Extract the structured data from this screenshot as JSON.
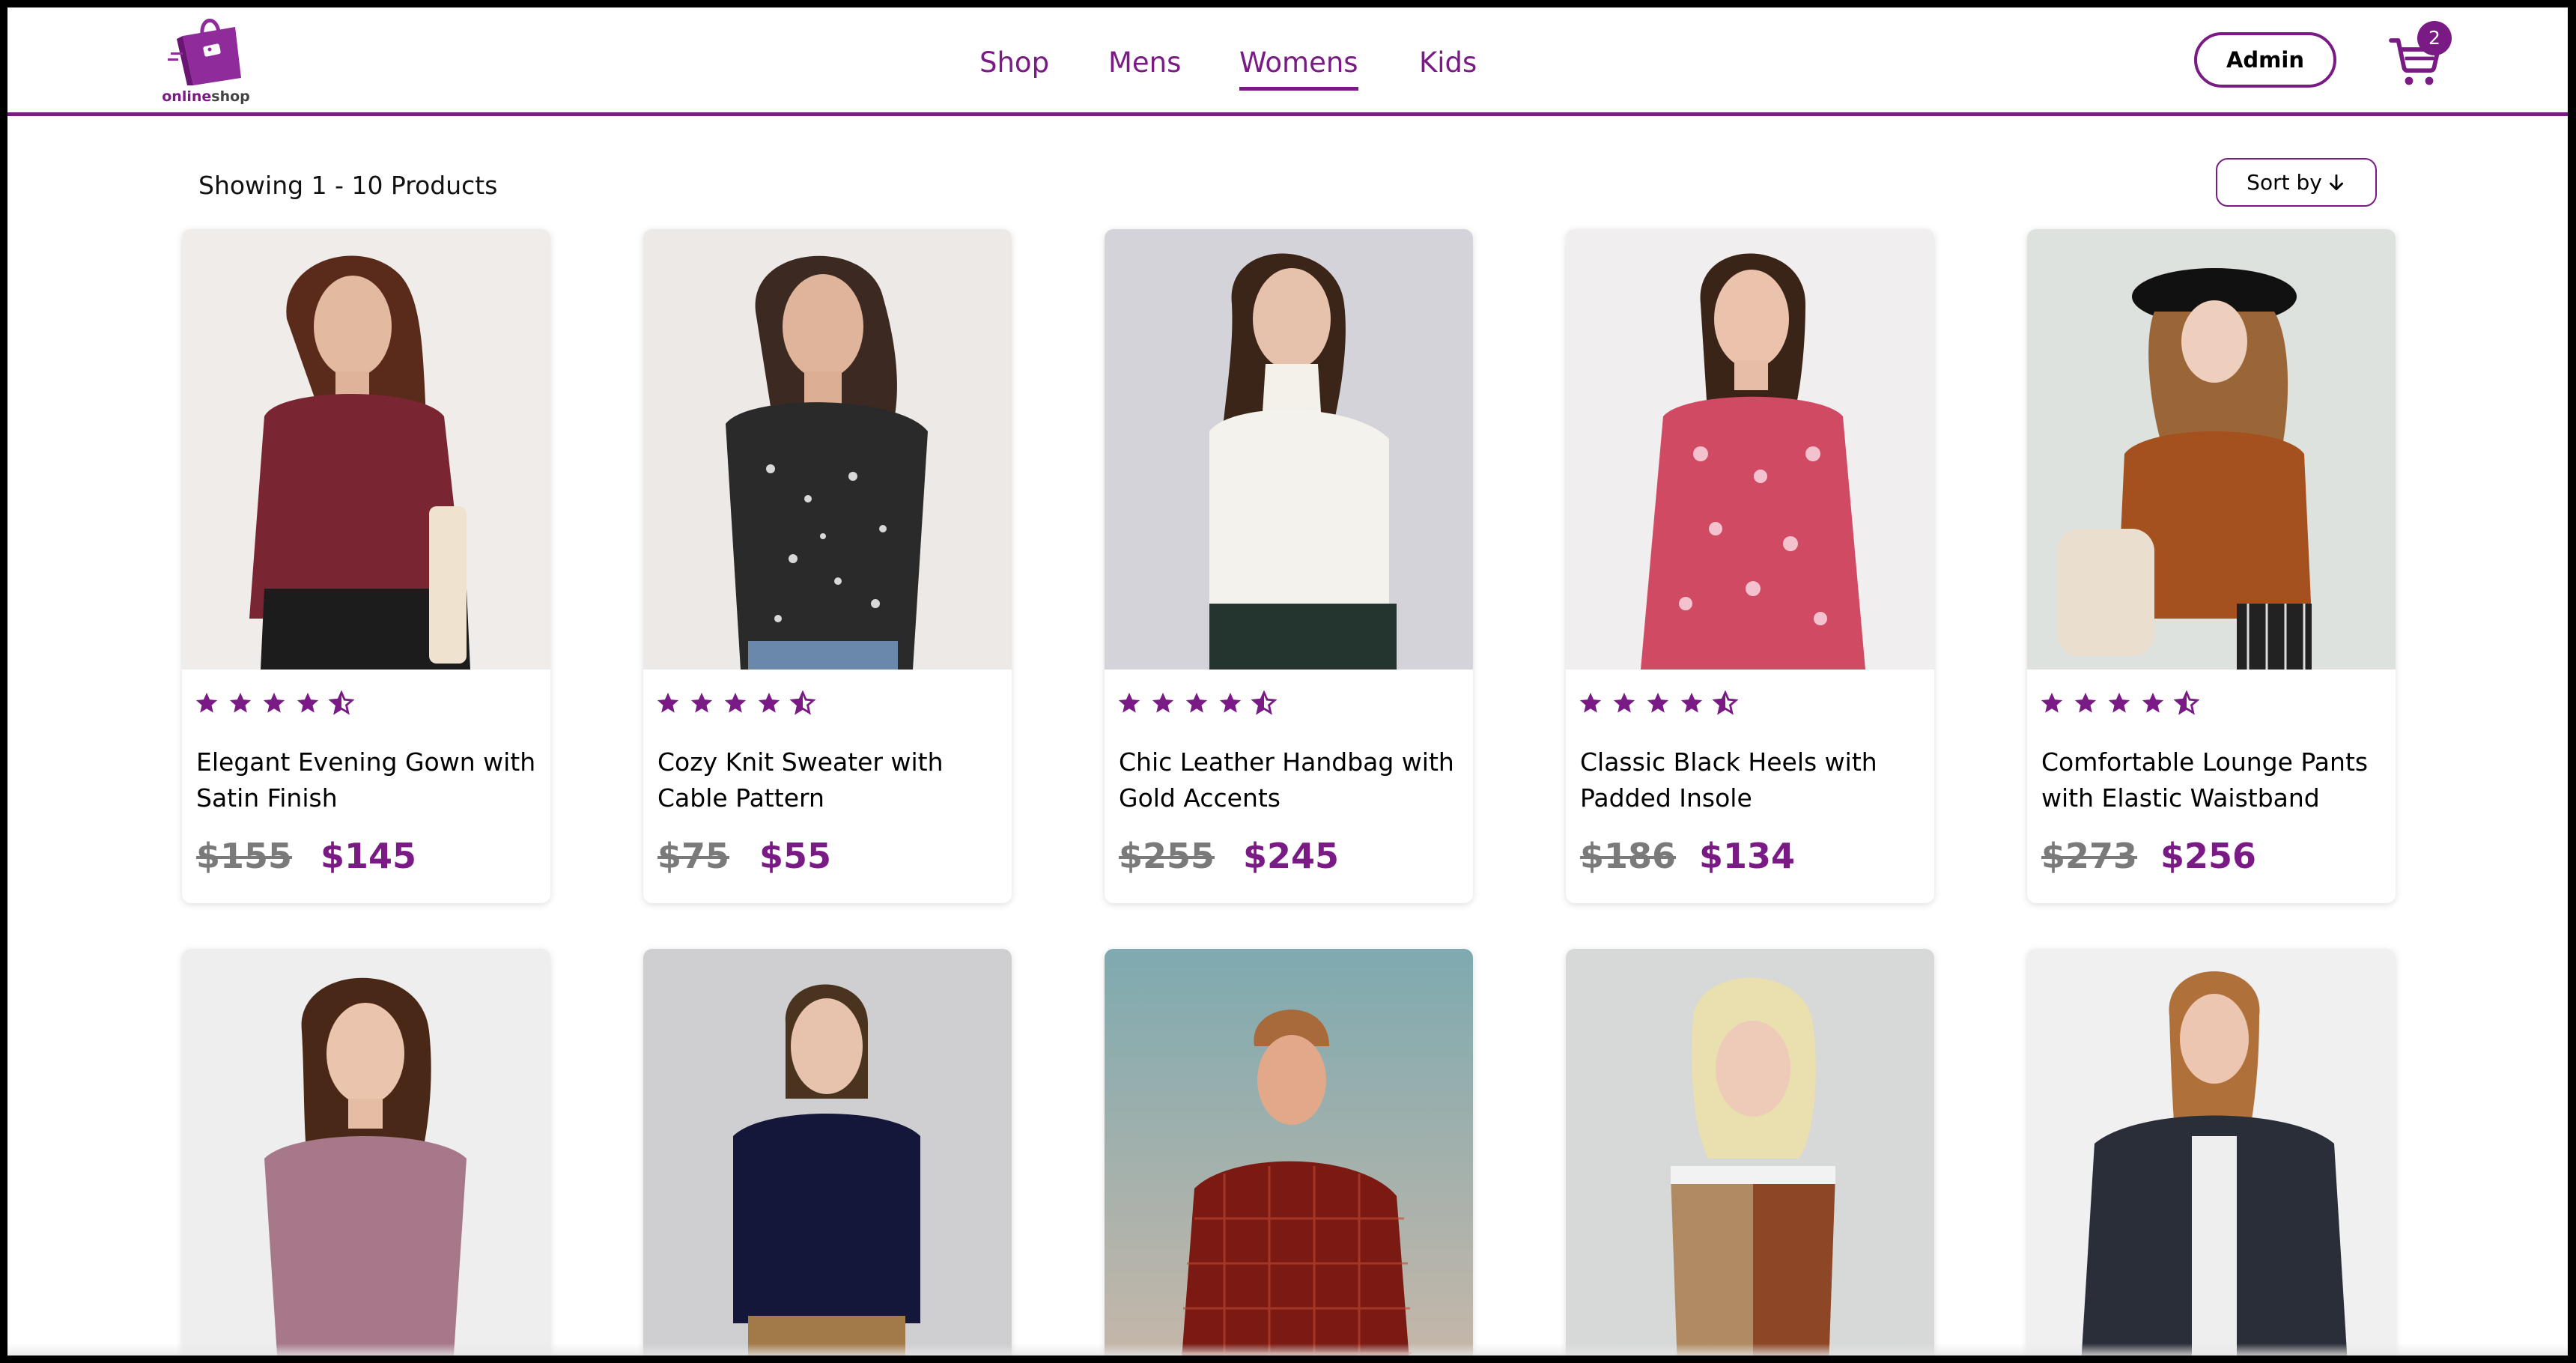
{
  "header": {
    "logo": {
      "part1": "online",
      "part2": "shop"
    },
    "nav": [
      {
        "label": "Shop",
        "active": false
      },
      {
        "label": "Mens",
        "active": false
      },
      {
        "label": "Womens",
        "active": true
      },
      {
        "label": "Kids",
        "active": false
      }
    ],
    "admin_label": "Admin",
    "cart_count": "2"
  },
  "toolbar": {
    "showing_text": "Showing 1 - 10 Products",
    "sort_label": "Sort by"
  },
  "colors": {
    "accent": "#7a1a85",
    "old_price": "#7a7a7a"
  },
  "products": [
    {
      "title": "Elegant Evening Gown with Satin Finish",
      "old_price": "$155",
      "price": "$145",
      "rating": 4.5,
      "image": "woman in maroon hoodie crop top with handbag"
    },
    {
      "title": "Cozy Knit Sweater with Cable Pattern",
      "old_price": "$75",
      "price": "$55",
      "rating": 4.5,
      "image": "woman in black floral print top"
    },
    {
      "title": "Chic Leather Handbag with Gold Accents",
      "old_price": "$255",
      "price": "$245",
      "rating": 4.5,
      "image": "woman in white turtleneck"
    },
    {
      "title": "Classic Black Heels with Padded Insole",
      "old_price": "$186",
      "price": "$134",
      "rating": 4.5,
      "image": "woman in pink floral dress"
    },
    {
      "title": "Comfortable Lounge Pants with Elastic Waistband",
      "old_price": "$273",
      "price": "$256",
      "rating": 4.5,
      "image": "woman in hijab and black hat with backpack"
    },
    {
      "image": "woman in mauve puff sleeve top"
    },
    {
      "image": "woman in navy top and tan pants"
    },
    {
      "image": "woman in red checkered top against blue sky"
    },
    {
      "image": "blonde woman in color-block sports top"
    },
    {
      "image": "woman in dark fur jacket"
    }
  ]
}
